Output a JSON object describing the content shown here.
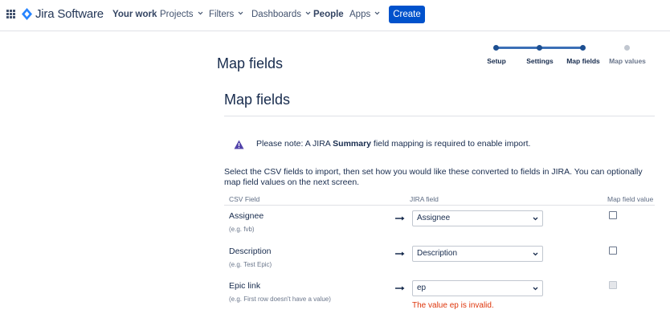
{
  "nav": {
    "brand": "Jira Software",
    "items": [
      {
        "label": "Your work",
        "bold": true,
        "dropdown": false
      },
      {
        "label": "Projects",
        "dropdown": true
      },
      {
        "label": "Filters",
        "dropdown": true
      },
      {
        "label": "Dashboards",
        "dropdown": true
      },
      {
        "label": "People",
        "bold": true,
        "dropdown": false
      },
      {
        "label": "Apps",
        "dropdown": true
      }
    ],
    "create_label": "Create"
  },
  "tracker": {
    "steps": [
      {
        "label": "Setup",
        "state": "complete"
      },
      {
        "label": "Settings",
        "state": "complete"
      },
      {
        "label": "Map fields",
        "state": "current"
      },
      {
        "label": "Map values",
        "state": "todo"
      }
    ]
  },
  "page": {
    "title": "Map fields",
    "section_title": "Map fields",
    "note_prefix": "Please note: A JIRA ",
    "note_bold": "Summary",
    "note_suffix": " field mapping is required to enable import.",
    "description": "Select the CSV fields to import, then set how you would like these converted to fields in JIRA. You can optionally map field values on the next screen."
  },
  "table": {
    "headers": {
      "csv": "CSV Field",
      "jira": "JIRA field",
      "map": "Map field value"
    },
    "rows": [
      {
        "name": "Assignee",
        "example": "(e.g. fvb)",
        "jira_value": "Assignee",
        "map_checked": false,
        "map_disabled": false
      },
      {
        "name": "Description",
        "example": "(e.g. Test Epic)",
        "jira_value": "Description",
        "map_checked": false,
        "map_disabled": false
      },
      {
        "name": "Epic link",
        "example": "(e.g. First row doesn't have a value)",
        "jira_value": "ep",
        "map_checked": false,
        "map_disabled": true
      }
    ],
    "error": "The value ep is invalid."
  },
  "colors": {
    "primary": "#0052cc",
    "tracker": "#1d4f91",
    "error": "#de350b",
    "warning_icon": "#5243aa"
  },
  "icons": [
    "app-switcher-icon",
    "jira-logo-icon",
    "chevron-down-icon",
    "warning-icon",
    "right-arrow-icon"
  ]
}
